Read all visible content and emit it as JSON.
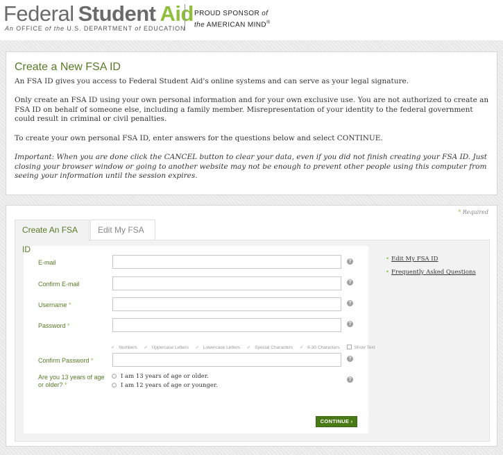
{
  "header": {
    "logo_federal": "Federal",
    "logo_student": "Student",
    "logo_aid": "Aid",
    "logo_sub_1": "An ",
    "logo_sub_office": "OFFICE",
    "logo_sub_of1": " of ",
    "logo_sub_the": "the",
    "logo_sub_dept": " U.S. DEPARTMENT ",
    "logo_sub_of2": "of",
    "logo_sub_edu": " EDUCATION",
    "sponsor_line1": "PROUD SPONSOR ",
    "sponsor_of": "of",
    "sponsor_the": "the",
    "sponsor_line2": " AMERICAN MIND",
    "sponsor_reg": "®"
  },
  "info": {
    "title": "Create a New FSA ID",
    "p1": "An FSA ID gives you access to Federal Student Aid's online systems and can serve as your legal signature.",
    "p2": "Only create an FSA ID using your own personal information and for your own exclusive use. You are not authorized to create an FSA ID on behalf of someone else, including a family member. Misrepresentation of your identity to the federal government could result in criminal or civil penalties.",
    "p3": "To create your own personal FSA ID, enter answers for the questions below and select CONTINUE.",
    "p4": "Important: When you are done click the CANCEL button to clear your data, even if you did not finish creating your FSA ID. Just closing your browser window or going to another website may not be enough to prevent other people using this computer from seeing your information until the session expires."
  },
  "form": {
    "required_star": "*",
    "required_label": " Required",
    "tabs": [
      {
        "label": "Create An FSA ID"
      },
      {
        "label": "Edit My FSA ID"
      }
    ],
    "fields": {
      "email_label": "E-mail",
      "confirm_email_label": "Confirm E-mail",
      "username_label": "Username",
      "password_label": "Password",
      "confirm_password_label": "Confirm Password",
      "age_label_1": "Are you 13 years of age",
      "age_label_2": "or older?",
      "star": " *",
      "email_value": "",
      "confirm_email_value": "",
      "username_value": "",
      "password_value": "",
      "confirm_password_value": ""
    },
    "hints": {
      "check": "✔",
      "numbers": "Numbers",
      "uppercase": "Uppercase Letters",
      "lowercase": "Lowercase Letters",
      "special": "Special Characters",
      "length": "8-30 Characters",
      "show_text": "Show Text"
    },
    "age_options": [
      {
        "label": "I am 13 years of age or older."
      },
      {
        "label": "I am 12 years of age or younger."
      }
    ],
    "help_glyph": "?",
    "continue_label": "CONTINUE ›"
  },
  "side_links": {
    "bullet": "•",
    "items": [
      {
        "label": "Edit My FSA ID"
      },
      {
        "label": "Frequently Asked Questions"
      }
    ]
  }
}
